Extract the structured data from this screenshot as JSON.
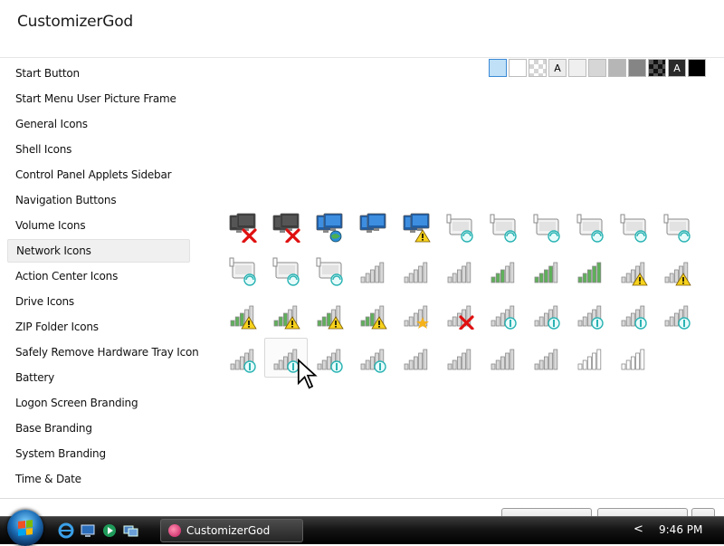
{
  "app": {
    "title": "CustomizerGod"
  },
  "sidebar": {
    "items": [
      {
        "label": "Start Button",
        "selected": false
      },
      {
        "label": "Start Menu User Picture Frame",
        "selected": false
      },
      {
        "label": "General Icons",
        "selected": false
      },
      {
        "label": "Shell Icons",
        "selected": false
      },
      {
        "label": "Control Panel Applets Sidebar",
        "selected": false
      },
      {
        "label": "Navigation Buttons",
        "selected": false
      },
      {
        "label": "Volume Icons",
        "selected": false
      },
      {
        "label": "Network Icons",
        "selected": true
      },
      {
        "label": "Action Center Icons",
        "selected": false
      },
      {
        "label": "Drive Icons",
        "selected": false
      },
      {
        "label": "ZIP Folder Icons",
        "selected": false
      },
      {
        "label": "Safely Remove Hardware Tray Icon",
        "selected": false
      },
      {
        "label": "Battery",
        "selected": false
      },
      {
        "label": "Logon Screen Branding",
        "selected": false
      },
      {
        "label": "Base Branding",
        "selected": false
      },
      {
        "label": "System Branding",
        "selected": false
      },
      {
        "label": "Time & Date",
        "selected": false
      }
    ]
  },
  "background_swatches": [
    {
      "color": "#bfe0f7",
      "label": "",
      "selected": true
    },
    {
      "color": "#ffffff",
      "label": ""
    },
    {
      "color": "checker",
      "label": ""
    },
    {
      "color": "#ececec",
      "label": "A",
      "text_color": "#000000"
    },
    {
      "color": "#efefef",
      "label": ""
    },
    {
      "color": "#d6d6d6",
      "label": ""
    },
    {
      "color": "#b6b6b6",
      "label": ""
    },
    {
      "color": "#858585",
      "label": ""
    },
    {
      "color": "dark-checker",
      "label": ""
    },
    {
      "color": "#2a2a2a",
      "label": "A",
      "text_color": "#ffffff"
    },
    {
      "color": "#000000",
      "label": ""
    }
  ],
  "icons": {
    "rows": [
      [
        "computer-disconnected-icon",
        "computer-disconnected-icon",
        "computer-internet-icon",
        "computers-network-icon",
        "computer-network-warning-icon",
        "modem-searching-icon",
        "modem-searching-icon",
        "modem-searching-icon",
        "modem-searching-icon",
        "modem-searching-icon",
        "modem-searching-icon"
      ],
      [
        "modem-searching-icon",
        "modem-searching-icon",
        "modem-searching-icon",
        "signal-bars-1-icon",
        "signal-bars-2-icon",
        "signal-bars-3-icon",
        "signal-bars-3-green-icon",
        "signal-bars-4-green-icon",
        "signal-bars-5-green-icon",
        "signal-bars-warning-icon",
        "signal-bars-warning-icon"
      ],
      [
        "signal-bars-warning-green-icon",
        "signal-bars-warning-green-icon",
        "signal-bars-warning-green-icon",
        "signal-bars-warning-green-icon",
        "signal-bars-star-icon",
        "signal-bars-disconnected-icon",
        "signal-bars-connecting-icon",
        "signal-bars-connecting-icon",
        "signal-bars-connecting-icon",
        "signal-bars-connecting-icon",
        "signal-bars-connecting-icon"
      ],
      [
        "signal-bars-connecting-icon",
        "signal-bars-connecting-icon",
        "signal-bars-connecting-icon",
        "signal-bars-connecting-icon",
        "signal-bars-gray-icon",
        "signal-bars-gray-icon",
        "signal-bars-gray-icon",
        "signal-bars-gray-icon",
        "signal-bars-outline-icon",
        "signal-bars-outline-icon"
      ]
    ],
    "hovered": {
      "row": 3,
      "col": 1
    }
  },
  "taskbar": {
    "window_button_label": "CustomizerGod",
    "clock": "9:46 PM",
    "tray_arrow": "<"
  }
}
